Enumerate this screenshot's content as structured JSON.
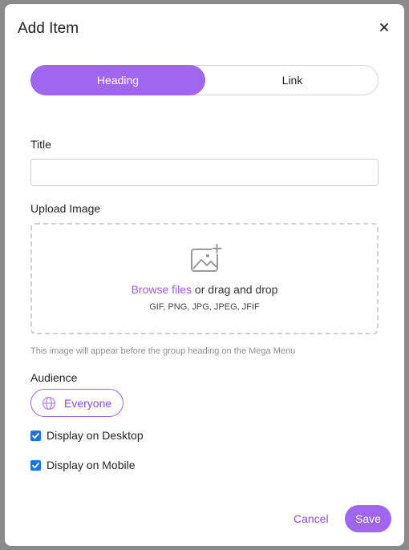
{
  "modal": {
    "title": "Add Item"
  },
  "tabs": [
    {
      "label": "Heading",
      "active": true
    },
    {
      "label": "Link",
      "active": false
    }
  ],
  "fields": {
    "title_label": "Title",
    "title_value": "",
    "upload_label": "Upload Image"
  },
  "upload": {
    "browse_link": "Browse files",
    "drag_text": " or drag and drop",
    "formats": "GIF, PNG, JPG, JPEG, JFIF",
    "icon": "image-add-icon",
    "hint": "This image will appear before the group heading on the Mega Menu"
  },
  "audience": {
    "label": "Audience",
    "value": "Everyone",
    "icon": "globe-icon"
  },
  "checkboxes": [
    {
      "label": "Display on Desktop",
      "checked": true
    },
    {
      "label": "Display on Mobile",
      "checked": true
    }
  ],
  "actions": {
    "cancel_label": "Cancel",
    "save_label": "Save"
  },
  "colors": {
    "accent": "#a066f0",
    "checkbox": "#1a73e8",
    "overlay": "#8a8a8a"
  }
}
